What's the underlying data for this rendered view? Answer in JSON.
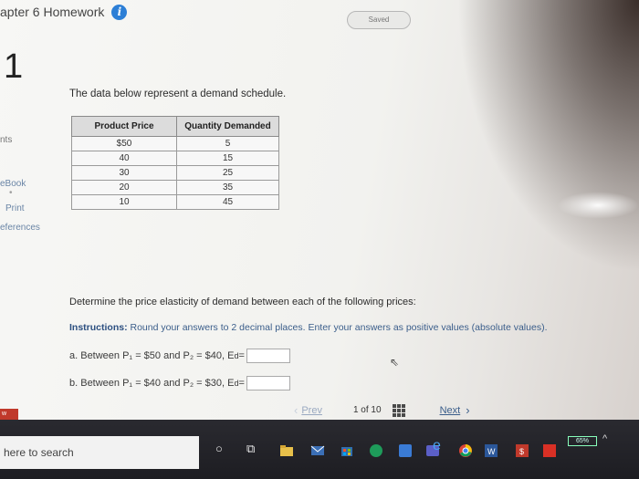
{
  "header": {
    "title": "apter 6 Homework",
    "saved_label": "Saved"
  },
  "question": {
    "number": "1",
    "intro": "The data below represent a demand schedule."
  },
  "sidebar": {
    "points": "nts",
    "ebook": "eBook",
    "print": "Print",
    "references": "eferences"
  },
  "table": {
    "headers": [
      "Product Price",
      "Quantity Demanded"
    ],
    "rows": [
      [
        "$50",
        "5"
      ],
      [
        "40",
        "15"
      ],
      [
        "30",
        "25"
      ],
      [
        "20",
        "35"
      ],
      [
        "10",
        "45"
      ]
    ]
  },
  "prompt": {
    "determine": "Determine the price elasticity of demand between each of the following prices:",
    "instructions_label": "Instructions:",
    "instructions_text": " Round your answers to 2 decimal places. Enter your answers as positive values (absolute values).",
    "part_a": "a. Between P₁ = $50 and P₂ = $40, E",
    "part_b": "b. Between P₁ = $40 and P₂ = $30, E",
    "ed_sub": "d",
    "eq": "="
  },
  "navigation": {
    "prev": "Prev",
    "page_indicator": "1 of 10",
    "next": "Next"
  },
  "taskbar": {
    "search_placeholder": "here to search",
    "battery": "65%"
  },
  "colors": {
    "accent": "#2d7fd6",
    "instructions": "#3a5d8a",
    "taskbar": "#1d1d22"
  }
}
